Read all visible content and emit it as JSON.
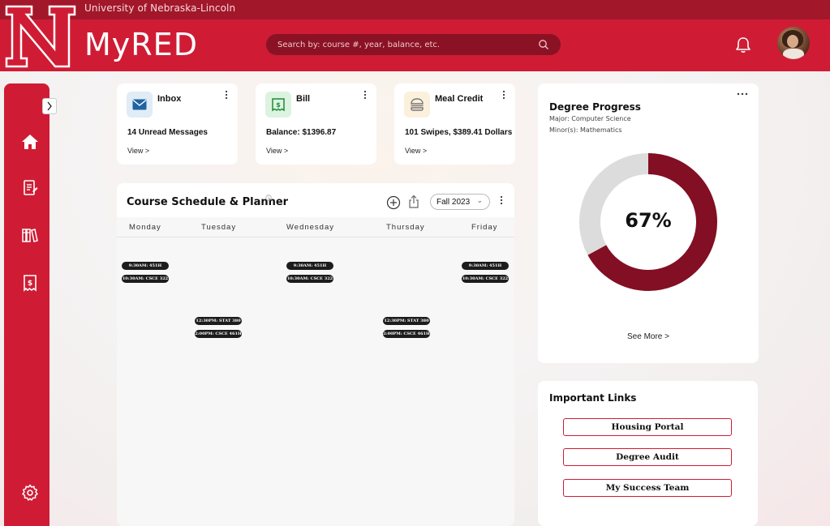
{
  "header": {
    "university": "University of Nebraska-Lincoln",
    "app_title": "MyRED",
    "search_placeholder": "Search by: course #, year, balance, etc.",
    "brand_color": "#cf1c34",
    "brand_dark": "#a3172a"
  },
  "sidebar": {
    "icons": [
      "home-icon",
      "document-icon",
      "library-books-icon",
      "bill-icon",
      "settings-icon"
    ]
  },
  "quick_cards": [
    {
      "title": "Inbox",
      "value": "14 Unread Messages",
      "view": "View  >",
      "icon": "mail-icon"
    },
    {
      "title": "Bill",
      "value": "Balance: $1396.87",
      "view": "View  >",
      "icon": "dollar-bill-icon"
    },
    {
      "title": "Meal Credit",
      "value": "101 Swipes, $389.41 Dollars",
      "view": "View  >",
      "icon": "burger-icon"
    }
  ],
  "schedule": {
    "title": "Course Schedule & Planner",
    "term": "Fall 2023",
    "days": [
      "Monday",
      "Tuesday",
      "Wednesday",
      "Thursday",
      "Friday"
    ],
    "classes": {
      "mon": [
        "9:30AM: 451H",
        "10:30AM: CSCE 322"
      ],
      "tue": [
        "12:30PM: STAT 380",
        "2:00PM: CSCE 461H"
      ],
      "wed": [
        "9:30AM: 451H",
        "10:30AM: CSCE 322"
      ],
      "thu": [
        "12:30PM: STAT 380",
        "2:00PM: CSCE 461H"
      ],
      "fri": [
        "9:30AM: 451H",
        "10:30AM: CSCE 322"
      ]
    }
  },
  "degree": {
    "title": "Degree Progress",
    "major": "Major: Computer Science",
    "minor": "Minor(s): Mathematics",
    "percent_label": "67%",
    "percent": 67,
    "see_more": "See More  >",
    "fill_color": "#820f23",
    "track_color": "#dcdcdc"
  },
  "links": {
    "title": "Important Links",
    "items": [
      "Housing Portal",
      "Degree Audit",
      "My Success Team"
    ]
  }
}
